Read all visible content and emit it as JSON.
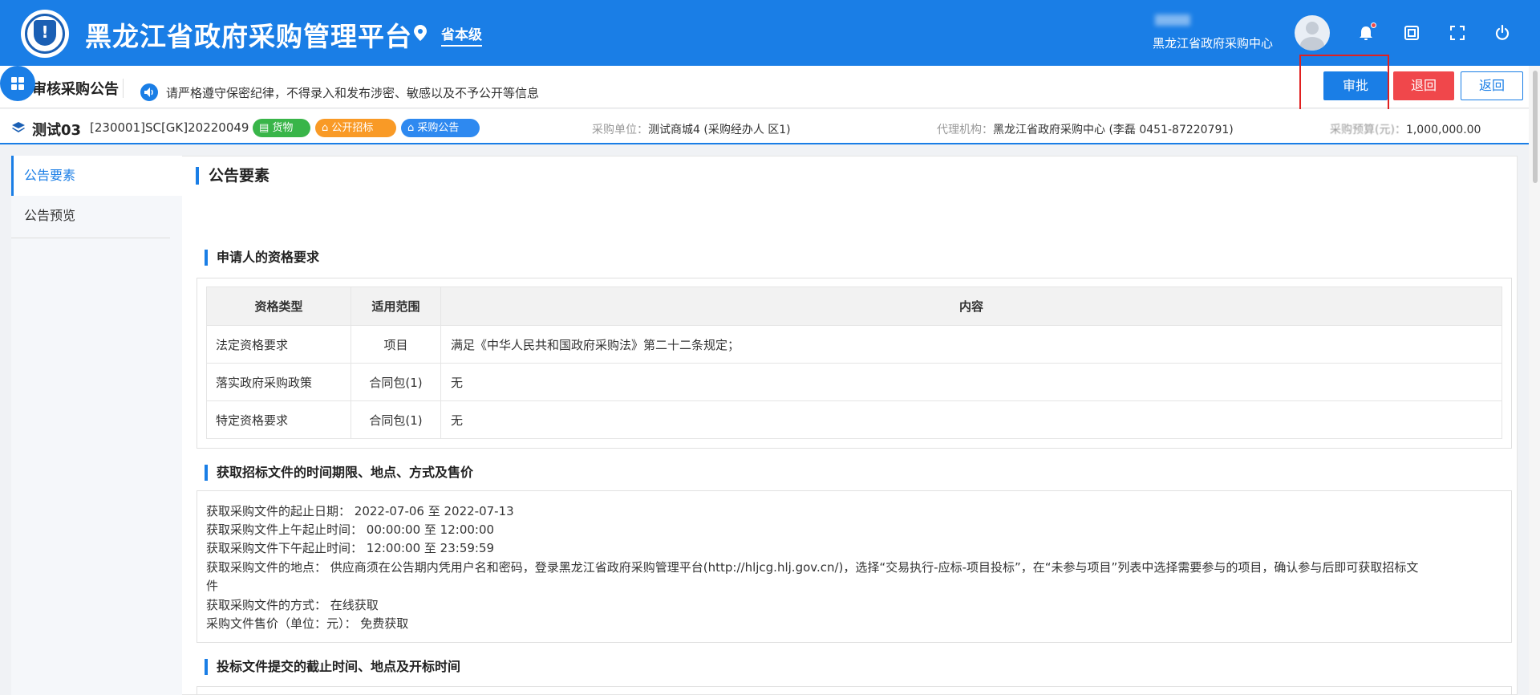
{
  "header": {
    "app_title": "黑龙江省政府采购管理平台",
    "level": "省本级",
    "user_org": "黑龙江省政府采购中心",
    "icons": [
      "location-icon",
      "bell-icon",
      "window-icon",
      "fullscreen-icon",
      "power-icon"
    ]
  },
  "toolbar": {
    "page_title": "审核采购公告",
    "notice": "请严格遵守保密纪律，不得录入和发布涉密、敏感以及不予公开等信息",
    "approve_label": "审批",
    "reject_label": "退回",
    "back_label": "返回"
  },
  "project": {
    "name": "测试03",
    "code": "[230001]SC[GK]20220049",
    "tags": [
      "货物",
      "公开招标",
      "采购公告"
    ],
    "unit_key": "采购单位：",
    "unit_val": "测试商城4 (采购经办人 区1)",
    "agency_key": "代理机构：",
    "agency_val": "黑龙江省政府采购中心 (李磊 0451-87220791)",
    "budget_key": "采购预算(元)：",
    "budget_val": "1,000,000.00"
  },
  "sidenav": {
    "items": [
      "公告要素",
      "公告预览"
    ]
  },
  "content": {
    "section_title": "公告要素",
    "qualification_title": "申请人的资格要求",
    "table": {
      "headers": [
        "资格类型",
        "适用范围",
        "内容"
      ],
      "rows": [
        [
          "法定资格要求",
          "项目",
          "满足《中华人民共和国政府采购法》第二十二条规定；"
        ],
        [
          "落实政府采购政策",
          "合同包(1)",
          "无"
        ],
        [
          "特定资格要求",
          "合同包(1)",
          "无"
        ]
      ]
    },
    "obtain_title": "获取招标文件的时间期限、地点、方式及售价",
    "obtain_lines": [
      "获取采购文件的起止日期：  2022-07-06 至 2022-07-13",
      "获取采购文件上午起止时间：  00:00:00 至 12:00:00",
      "获取采购文件下午起止时间：  12:00:00 至 23:59:59",
      "获取采购文件的地点：  供应商须在公告期内凭用户名和密码，登录黑龙江省政府采购管理平台(http://hljcg.hlj.gov.cn/)，选择“交易执行-应标-项目投标”，在“未参与项目”列表中选择需要参与的项目，确认参与后即可获取招标文",
      "件",
      "获取采购文件的方式：  在线获取",
      "采购文件售价（单位：元）：  免费获取"
    ],
    "deadline_title": "投标文件提交的截止时间、地点及开标时间"
  },
  "colors": {
    "primary": "#1a7ee6",
    "danger": "#f0474b",
    "goods_tag": "#39b549",
    "bid_tag": "#f99a26",
    "notice_tag": "#2e89f0"
  }
}
